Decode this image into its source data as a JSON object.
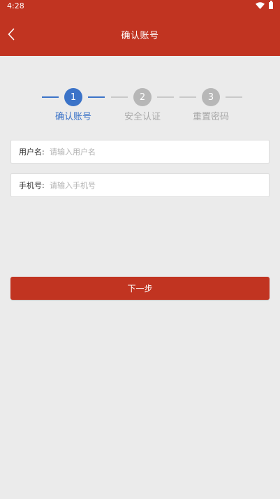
{
  "status_bar": {
    "time": "4:28"
  },
  "app_bar": {
    "title": "确认账号"
  },
  "steps": [
    {
      "number": "1",
      "label": "确认账号",
      "active": true
    },
    {
      "number": "2",
      "label": "安全认证",
      "active": false
    },
    {
      "number": "3",
      "label": "重置密码",
      "active": false
    }
  ],
  "form": {
    "username": {
      "label": "用户名:",
      "placeholder": "请输入用户名",
      "value": ""
    },
    "phone": {
      "label": "手机号:",
      "placeholder": "请输入手机号",
      "value": ""
    }
  },
  "next_button": {
    "label": "下一步"
  },
  "colors": {
    "primary": "#c13421",
    "accent": "#3b73c8",
    "inactive": "#b7b7b7",
    "background": "#ebebeb"
  }
}
